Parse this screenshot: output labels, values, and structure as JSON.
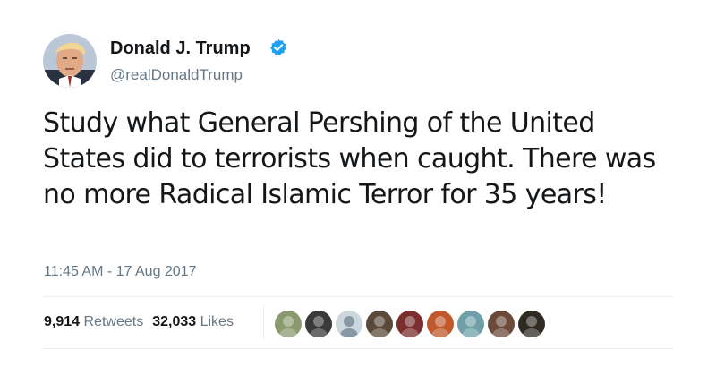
{
  "tweet": {
    "author": {
      "display_name": "Donald J. Trump",
      "handle": "@realDonaldTrump",
      "verified": true,
      "avatar_icon": "profile-photo"
    },
    "text": "Study what General Pershing of the United States did to terrorists when caught. There was no more Radical Islamic Terror for 35 years!",
    "timestamp": "11:45 AM - 17 Aug 2017",
    "stats": {
      "retweets_count": "9,914",
      "retweets_label": "Retweets",
      "likes_count": "32,033",
      "likes_label": "Likes"
    },
    "liker_avatars": [
      {
        "icon": "user-avatar",
        "color": "#8a9a6e"
      },
      {
        "icon": "user-avatar",
        "color": "#3a3a3a"
      },
      {
        "icon": "default-avatar",
        "color": "#ccd6dd"
      },
      {
        "icon": "user-avatar",
        "color": "#5b4a3a"
      },
      {
        "icon": "user-avatar",
        "color": "#7a2e2e"
      },
      {
        "icon": "user-avatar",
        "color": "#c0592b"
      },
      {
        "icon": "user-avatar",
        "color": "#6fa0a8"
      },
      {
        "icon": "user-avatar",
        "color": "#6b4a3a"
      },
      {
        "icon": "user-avatar",
        "color": "#2f2a22"
      }
    ]
  },
  "colors": {
    "text_primary": "#14171a",
    "text_secondary": "#657786",
    "verified_blue": "#1da1f2",
    "divider": "#e6ecf0"
  }
}
